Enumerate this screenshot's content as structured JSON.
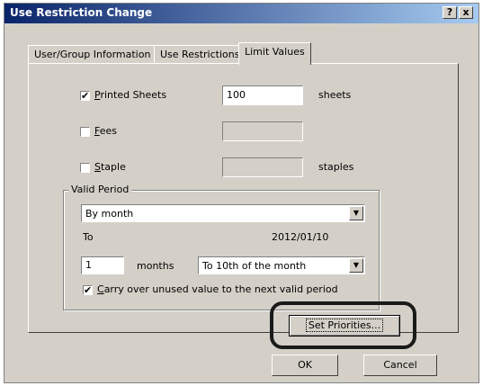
{
  "window": {
    "title": "Use Restriction Change",
    "help_label": "?",
    "close_label": "x"
  },
  "tabs": [
    {
      "label": "User/Group Information"
    },
    {
      "label": "Use Restrictions"
    },
    {
      "label": "Limit Values"
    }
  ],
  "limits": {
    "printed_sheets": {
      "first_letter": "P",
      "rest": "rinted Sheets",
      "checked": true,
      "value": "100",
      "unit": "sheets"
    },
    "fees": {
      "first_letter": "F",
      "rest": "ees",
      "checked": false,
      "value": ""
    },
    "staple": {
      "first_letter": "S",
      "rest": "taple",
      "checked": false,
      "value": "",
      "unit": "staples"
    }
  },
  "valid_period": {
    "legend": "Valid Period",
    "period_option": "By month",
    "to_label": "To",
    "to_date": "2012/01/10",
    "months_value": "1",
    "months_label": "months",
    "day_option": "To 10th of the month",
    "carry_over": {
      "first_letter": "C",
      "rest": "arry over unused value to the next valid period",
      "checked": true
    }
  },
  "buttons": {
    "set_priorities": "Set Priorities...",
    "ok": "OK",
    "cancel": "Cancel"
  },
  "check_mark": "✔",
  "colors": {
    "titlebar": "#0a246a",
    "dialog_bg": "#d4d0c8",
    "highlight_ring": "#1a1a1a"
  }
}
